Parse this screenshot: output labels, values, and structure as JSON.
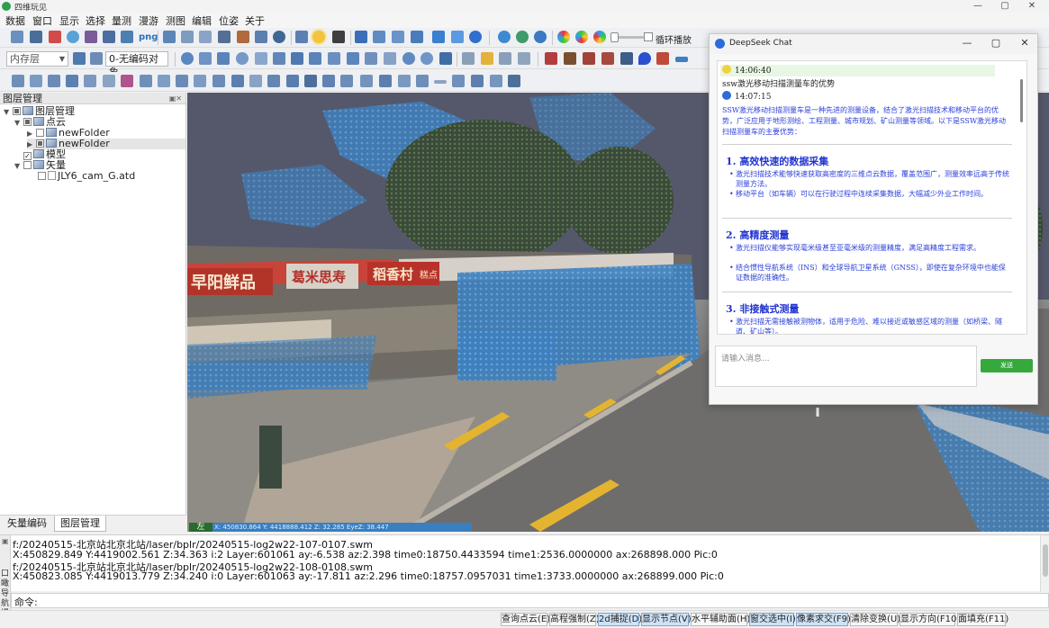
{
  "window": {
    "title": "四维玩见",
    "controls": [
      "—",
      "▢",
      "✕"
    ]
  },
  "menu": [
    "数据",
    "窗口",
    "显示",
    "选择",
    "量测",
    "漫游",
    "测图",
    "编辑",
    "位姿",
    "关于"
  ],
  "toolbar": {
    "png_label": "png",
    "loop_label": "循环播放",
    "layer_dropdown": "内存层",
    "code_dropdown": "0-无编码对象"
  },
  "layer_panel": {
    "title": "图层管理",
    "nodes": [
      {
        "label": "图层管理",
        "level": 0
      },
      {
        "label": "点云",
        "level": 1
      },
      {
        "label": "newFolder",
        "level": 2
      },
      {
        "label": "newFolder",
        "level": 2
      },
      {
        "label": "模型",
        "level": 1
      },
      {
        "label": "矢量",
        "level": 1
      },
      {
        "label": "JLY6_cam_G.atd",
        "level": 2
      }
    ],
    "tabs": [
      "矢量编码",
      "图层管理"
    ]
  },
  "viewport": {
    "coord_tag": "左",
    "coord_text": "X: 450830.864 Y: 4418888.412 Z: 32.285 EyeZ: 38.447",
    "shop_signs": [
      "早阳鲜品",
      "葛米思寿",
      "稻香村",
      "糕点"
    ]
  },
  "log": {
    "lines": [
      "f:/20240515-北京站北京北站/laser/bplr/20240515-log2w22-107-0107.swm",
      "X:450829.849 Y:4419002.561 Z:34.363 i:2 Layer:601061 ay:-6.538 az:2.398 time0:18750.4433594 time1:2536.0000000 ax:268898.000 Pic:0",
      "f:/20240515-北京站北京北站/laser/bplr/20240515-log2w22-108-0108.swm",
      "X:450823.085 Y:4419013.779 Z:34.240 i:0 Layer:601063 ay:-17.811 az:2.296 time0:18757.0957031 time1:3733.0000000 ax:268899.000 Pic:0"
    ],
    "side_label": "口瞰\n导航\n提示"
  },
  "command": {
    "label": "命令:"
  },
  "statusbar": [
    {
      "label": "查询点云(E)",
      "on": false
    },
    {
      "label": "高程强制(Z)",
      "on": false
    },
    {
      "label": "2d捕捉(D)",
      "on": true
    },
    {
      "label": "显示节点(V)",
      "on": true
    },
    {
      "label": "水平辅助面(H)",
      "on": false
    },
    {
      "label": "窗交选中(I)",
      "on": true
    },
    {
      "label": "像素求交(F9)",
      "on": true
    },
    {
      "label": "清除变换(U)",
      "on": false
    },
    {
      "label": "显示方向(F10)",
      "on": false
    },
    {
      "label": "面填充(F11)",
      "on": false
    }
  ],
  "chat": {
    "title": "DeepSeek Chat",
    "user_time": "14:06:40",
    "user_text": "ssw激光移动扫描测量车的优势",
    "bot_time": "14:07:15",
    "bot_intro": "SSW激光移动扫描测量车是一种先进的测量设备，结合了激光扫描技术和移动平台的优势，广泛应用于地形测绘、工程测量、城市规划、矿山测量等领域。以下是SSW激光移动扫描测量车的主要优势：",
    "sections": [
      {
        "title": "1.  高效快速的数据采集",
        "bullets": [
          "激光扫描技术能够快速获取高密度的三维点云数据，覆盖范围广，测量效率远高于传统测量方法。",
          "移动平台（如车辆）可以在行驶过程中连续采集数据，大幅减少外业工作时间。"
        ]
      },
      {
        "title": "2.  高精度测量",
        "bullets": [
          "激光扫描仪能够实现毫米级甚至亚毫米级的测量精度，满足高精度工程需求。",
          "结合惯性导航系统（INS）和全球导航卫星系统（GNSS），即使在复杂环境中也能保证数据的准确性。"
        ]
      },
      {
        "title": "3.  非接触式测量",
        "bullets": [
          "激光扫描无需接触被测物体，适用于危险、难以接近或敏感区域的测量（如桥梁、隧道、矿山等）。"
        ]
      }
    ],
    "input_placeholder": "请输入消息...",
    "send_label": "发送"
  }
}
